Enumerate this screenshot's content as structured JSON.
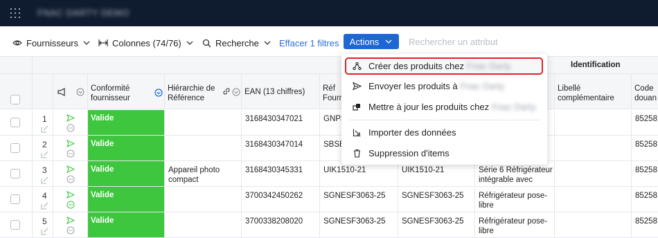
{
  "app": {
    "title": "FNAC DARTY DEMO"
  },
  "toolbar": {
    "suppliers_label": "Fournisseurs",
    "columns_label": "Colonnes (74/76)",
    "search_label": "Recherche",
    "clear_filters": "Effacer 1 filtres",
    "actions_label": "Actions",
    "attribute_search_placeholder": "Rechercher un attribut"
  },
  "menu": {
    "items": [
      {
        "label": "Créer des produits chez",
        "target": "Fnac Darty",
        "icon": "share-icon"
      },
      {
        "label": "Envoyer les produits à",
        "target": "Fnac Darty",
        "icon": "send-icon"
      },
      {
        "label": "Mettre à jour les produits chez",
        "target": "Fnac Darty",
        "icon": "update-icon"
      },
      {
        "label": "Importer des données",
        "target": "",
        "icon": "import-icon"
      },
      {
        "label": "Suppression d'items",
        "target": "",
        "icon": "trash-icon"
      }
    ]
  },
  "table": {
    "group_header": "Identification",
    "headers": {
      "conformity": "Conformité fournisseur",
      "hierarchy": "Hiérarchie de Référence",
      "ean": "EAN (13 chiffres)",
      "ref_supplier": "Réf Fourn",
      "label_extra": "Libellé complémentaire",
      "customs_code": "Code douan"
    },
    "rows": [
      {
        "num": "1",
        "status": "Valide",
        "hierarchy": "",
        "ean": "3168430347021",
        "ref": "GNP3",
        "ref2": "",
        "designation": "",
        "customs": "85258"
      },
      {
        "num": "2",
        "status": "Valide",
        "hierarchy": "",
        "ean": "3168430347014",
        "ref": "SBSEF",
        "ref2": "",
        "designation": "",
        "customs": "85258"
      },
      {
        "num": "3",
        "status": "Valide",
        "hierarchy": "Appareil photo compact",
        "ean": "3168430345331",
        "ref": "UIK1510-21",
        "ref2": "UIK1510-21",
        "designation": "Série 6 Réfrigérateur intégrable avec",
        "customs": "85258"
      },
      {
        "num": "4",
        "status": "Valide",
        "hierarchy": "",
        "ean": "3700342450262",
        "ref": "SGNESF3063-25",
        "ref2": "SGNESF3063-25",
        "designation": "Réfrigérateur pose-libre",
        "customs": "85258"
      },
      {
        "num": "5",
        "status": "Valide",
        "hierarchy": "",
        "ean": "3700338208020",
        "ref": "SGNESF3063-25",
        "ref2": "SGNESF3063-25",
        "designation": "Réfrigérateur pose-libre",
        "customs": "85258"
      }
    ]
  },
  "colors": {
    "topbar": "#0f1c30",
    "accent": "#1d66d3",
    "valid_green": "#3ec73e",
    "highlight_red": "#d9252b"
  }
}
